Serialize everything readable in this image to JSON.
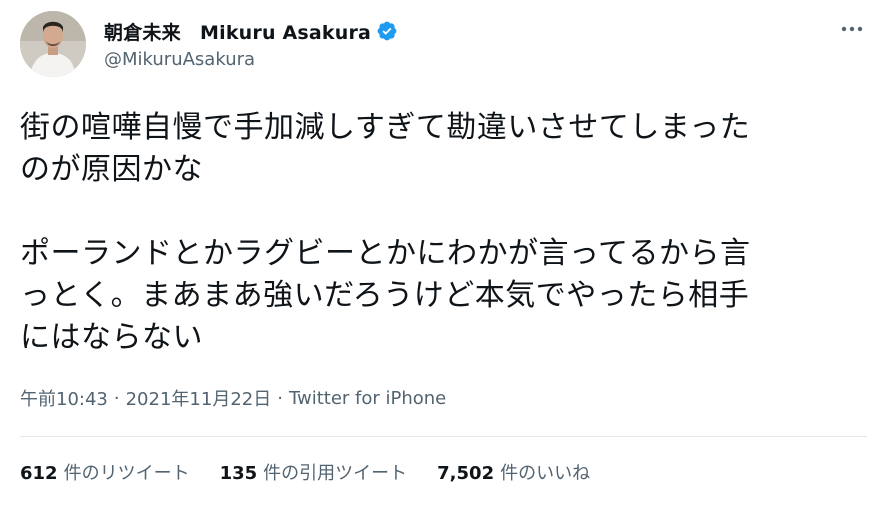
{
  "user": {
    "display_name": "朝倉未来　Mikuru Asakura",
    "handle": "@MikuruAsakura",
    "verified": true,
    "verified_color": "#1d9bf0"
  },
  "tweet": {
    "paragraphs": [
      [
        "街の喧嘩自慢で手加減しすぎて勘違いさせてしまった",
        "のが原因かな"
      ],
      [
        "ポーランドとかラグビーとかにわかが言ってるから言",
        "っとく。まあまあ強いだろうけど本気でやったら相手",
        "にはならない"
      ]
    ],
    "time": "午前10:43",
    "date": "2021年11月22日",
    "source": "Twitter for iPhone"
  },
  "stats": {
    "retweets_count": "612",
    "retweets_label": "件のリツイート",
    "quotes_count": "135",
    "quotes_label": "件の引用ツイート",
    "likes_count": "7,502",
    "likes_label": "件のいいね"
  },
  "icons": {
    "verified": "verified-badge-icon",
    "more": "more-options-icon"
  }
}
